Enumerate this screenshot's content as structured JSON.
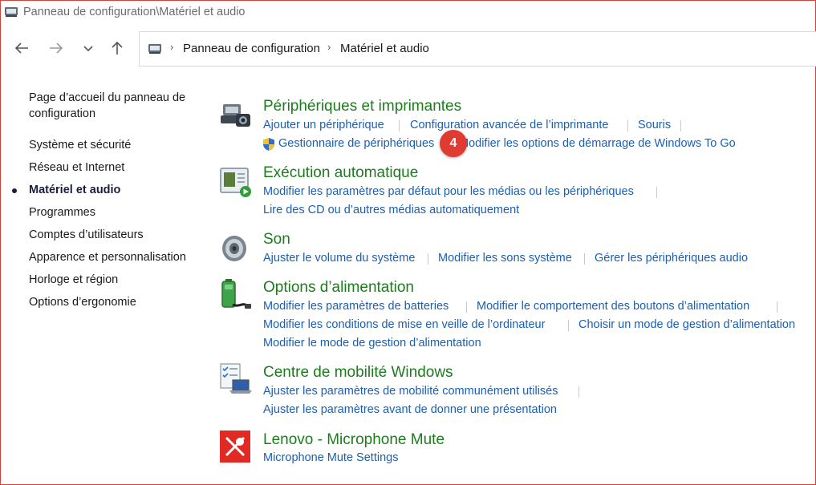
{
  "window": {
    "title": "Panneau de configuration\\Matériel et audio"
  },
  "address": {
    "crumbs": [
      "Panneau de configuration",
      "Matériel et audio"
    ]
  },
  "sidebar": {
    "home": "Page d’accueil du panneau de configuration",
    "items": [
      "Système et sécurité",
      "Réseau et Internet",
      "Matériel et audio",
      "Programmes",
      "Comptes d’utilisateurs",
      "Apparence et personnalisation",
      "Horloge et région",
      "Options d’ergonomie"
    ],
    "current": "Matériel et audio"
  },
  "categories": [
    {
      "title": "Périphériques et imprimantes",
      "icon": "devices-printers-icon",
      "links": [
        "Ajouter un périphérique",
        "Configuration avancée de l’imprimante",
        "Souris",
        "Gestionnaire de périphériques",
        "Modifier les options de démarrage de Windows To Go"
      ]
    },
    {
      "title": "Exécution automatique",
      "icon": "autoplay-icon",
      "links": [
        "Modifier les paramètres par défaut pour les médias ou les périphériques",
        "Lire des CD ou d’autres médias automatiquement"
      ]
    },
    {
      "title": "Son",
      "icon": "speaker-icon",
      "links": [
        "Ajuster le volume du système",
        "Modifier les sons système",
        "Gérer les périphériques audio"
      ]
    },
    {
      "title": "Options d’alimentation",
      "icon": "battery-power-icon",
      "links": [
        "Modifier les paramètres de batteries",
        "Modifier le comportement des boutons d’alimentation",
        "Modifier les conditions de mise en veille de l’ordinateur",
        "Choisir un mode de gestion d’alimentation",
        "Modifier le mode de gestion d’alimentation"
      ]
    },
    {
      "title": "Centre de mobilité Windows",
      "icon": "mobility-center-icon",
      "links": [
        "Ajuster les paramètres de mobilité communément utilisés",
        "Ajuster les paramètres avant de donner une présentation"
      ]
    },
    {
      "title": "Lenovo - Microphone Mute",
      "icon": "microphone-mute-icon",
      "links": [
        "Microphone Mute Settings"
      ]
    }
  ],
  "annotation": {
    "badge": "4"
  },
  "colors": {
    "link": "#1a5fb4",
    "category_title": "#1e7b1e",
    "badge": "#e03b30",
    "frame": "#d8413a"
  }
}
